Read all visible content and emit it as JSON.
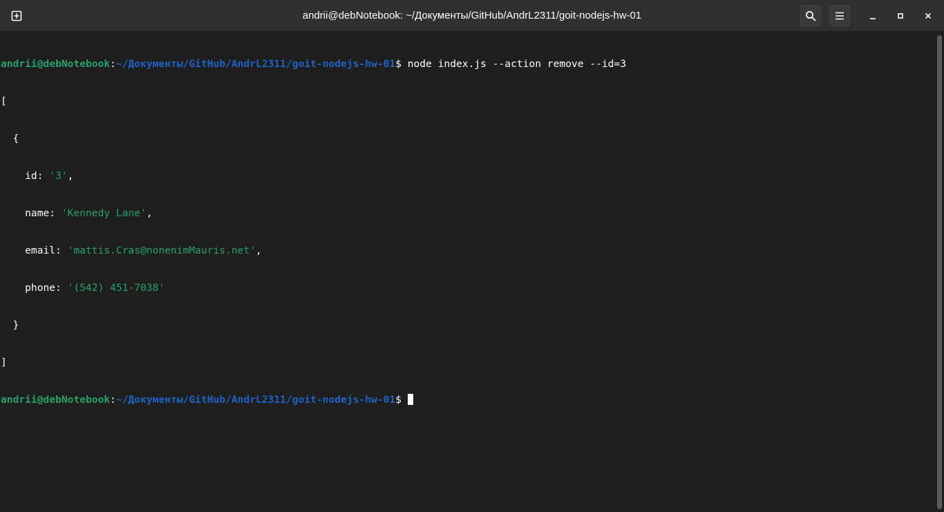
{
  "window": {
    "title": "andrii@debNotebook: ~/Документы/GitHub/AndrL2311/goit-nodejs-hw-01"
  },
  "titlebar": {
    "buttons": [
      {
        "name": "new-tab",
        "icon": "new-tab-icon"
      },
      {
        "name": "search",
        "icon": "search-icon"
      },
      {
        "name": "menu",
        "icon": "hamburger-menu-icon"
      },
      {
        "name": "minimize",
        "icon": "minimize-icon"
      },
      {
        "name": "maximize",
        "icon": "maximize-icon"
      },
      {
        "name": "close",
        "icon": "close-icon"
      }
    ]
  },
  "terminal": {
    "prompt_user": "andrii@debNotebook",
    "prompt_colon": ":",
    "prompt_path": "~/Документы/GitHub/AndrL2311/goit-nodejs-hw-01",
    "prompt_symbol": "$ ",
    "command": "node index.js --action remove --id=3",
    "output": {
      "open_bracket": "[",
      "open_brace": "  {",
      "fields": [
        {
          "key": "    id: ",
          "value": "'3'",
          "tail": ","
        },
        {
          "key": "    name: ",
          "value": "'Kennedy Lane'",
          "tail": ","
        },
        {
          "key": "    email: ",
          "value": "'mattis.Cras@nonenimMauris.net'",
          "tail": ","
        },
        {
          "key": "    phone: ",
          "value": "'(542) 451-7038'",
          "tail": ""
        }
      ],
      "close_brace": "  }",
      "close_bracket": "]"
    }
  },
  "colors": {
    "background": "#1e1e1e",
    "titlebar": "#303030",
    "prompt_user": "#26a269",
    "prompt_path": "#1f63c4",
    "string": "#26a269",
    "text": "#ffffff"
  }
}
